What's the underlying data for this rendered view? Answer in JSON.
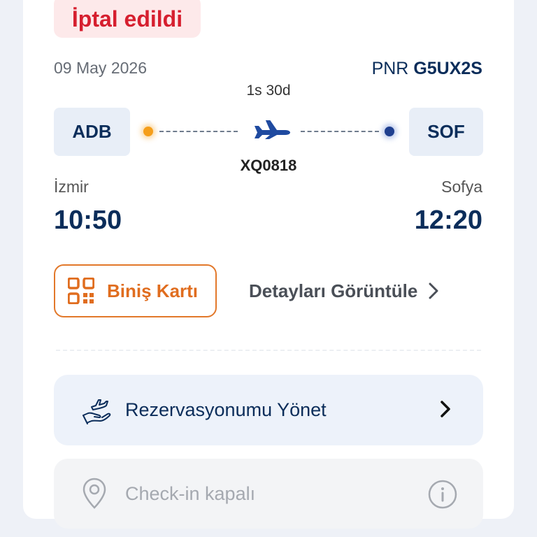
{
  "booking": {
    "status": "İptal edildi",
    "date": "09 May 2026",
    "pnr_label": "PNR",
    "pnr_code": "G5UX2S",
    "duration": "1s 30d",
    "flight_number": "XQ0818"
  },
  "origin": {
    "code": "ADB",
    "city": "İzmir",
    "time": "10:50"
  },
  "destination": {
    "code": "SOF",
    "city": "Sofya",
    "time": "12:20"
  },
  "actions": {
    "boarding_pass_label": "Biniş Kartı",
    "details_label": "Detayları Görüntüle"
  },
  "menu": {
    "manage_label": "Rezervasyonumu Yönet",
    "checkin_label": "Check-in kapalı"
  },
  "colors": {
    "cancelled": "#d61f2f",
    "brand_navy": "#0b2d5a",
    "accent_orange": "#e2782a"
  },
  "icons": {
    "boarding_pass": "qr-code-icon",
    "details": "chevron-right-icon",
    "flight": "airplane-icon",
    "manage": "hand-plane-icon",
    "checkin": "location-pin-icon",
    "info": "info-icon"
  }
}
